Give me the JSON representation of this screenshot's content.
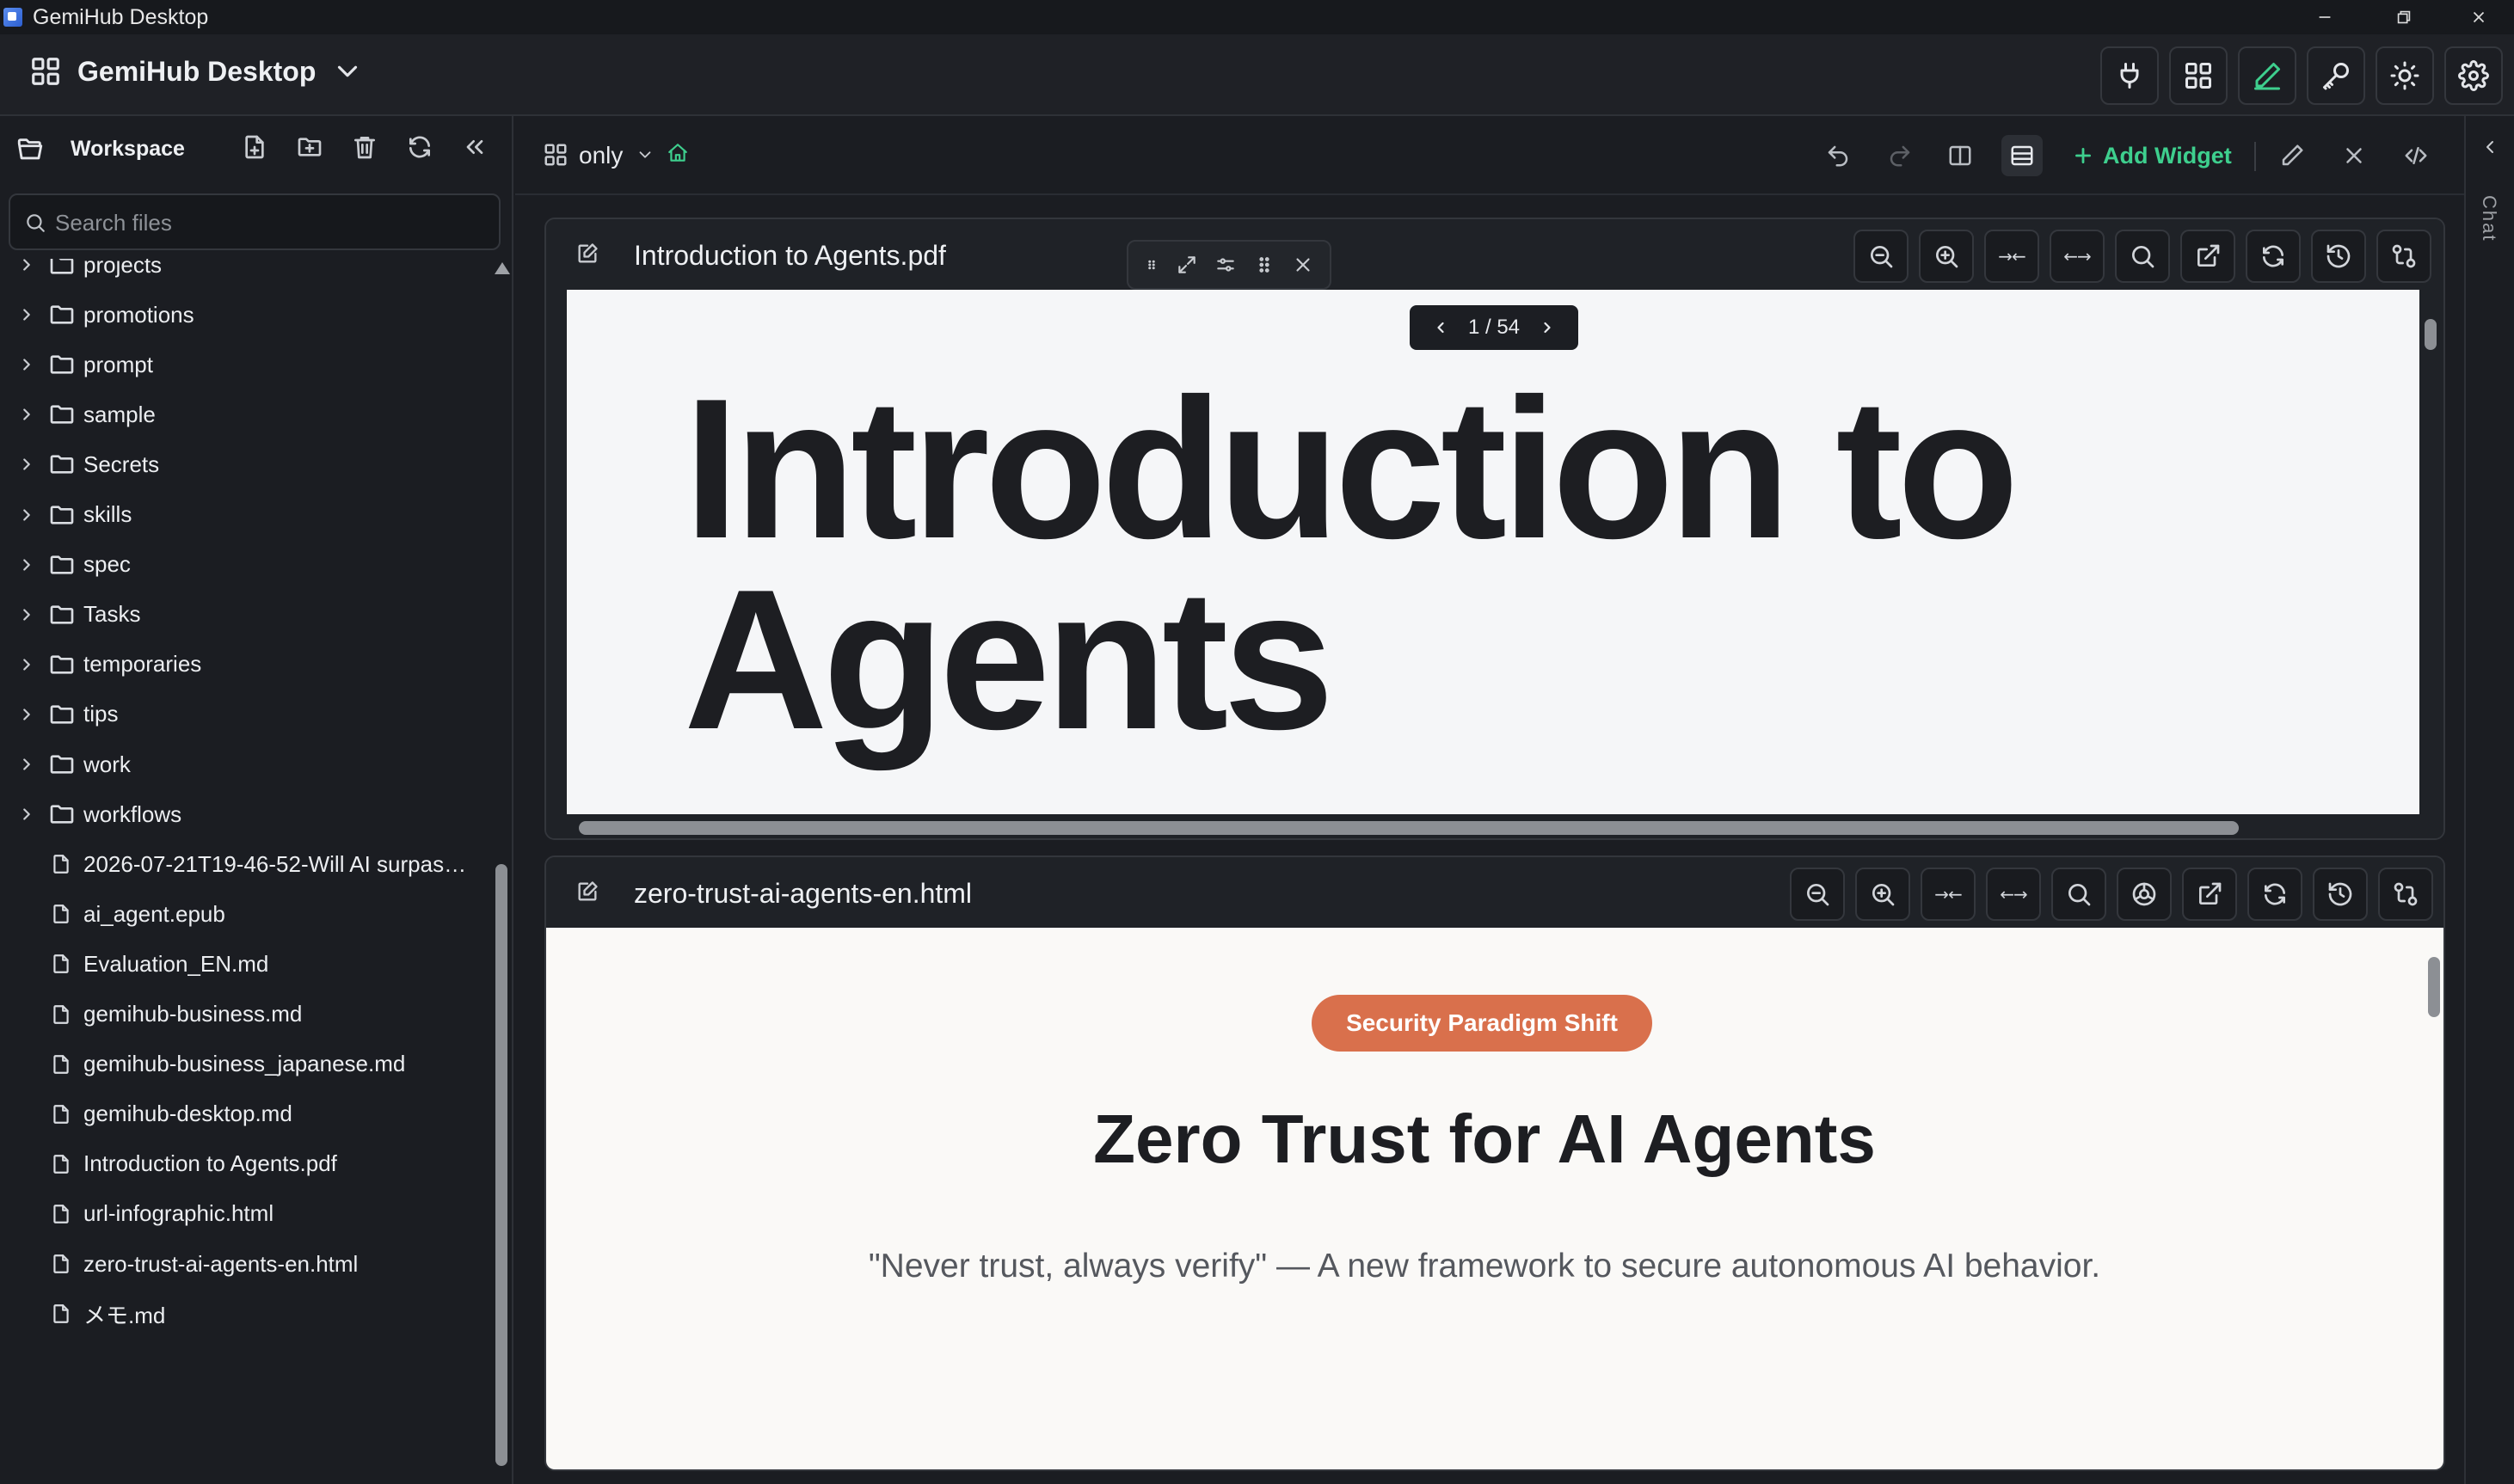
{
  "window": {
    "title": "GemiHub Desktop"
  },
  "header": {
    "app_name": "GemiHub Desktop"
  },
  "workspace": {
    "title": "Workspace",
    "search_placeholder": "Search files",
    "tree": [
      {
        "type": "folder",
        "name": "projects"
      },
      {
        "type": "folder",
        "name": "promotions"
      },
      {
        "type": "folder",
        "name": "prompt"
      },
      {
        "type": "folder",
        "name": "sample"
      },
      {
        "type": "folder",
        "name": "Secrets"
      },
      {
        "type": "folder",
        "name": "skills"
      },
      {
        "type": "folder",
        "name": "spec"
      },
      {
        "type": "folder",
        "name": "Tasks"
      },
      {
        "type": "folder",
        "name": "temporaries"
      },
      {
        "type": "folder",
        "name": "tips"
      },
      {
        "type": "folder",
        "name": "work"
      },
      {
        "type": "folder",
        "name": "workflows"
      },
      {
        "type": "file",
        "name": "2026-07-21T19-46-52-Will AI surpass ..."
      },
      {
        "type": "file",
        "name": "ai_agent.epub"
      },
      {
        "type": "file",
        "name": "Evaluation_EN.md"
      },
      {
        "type": "file",
        "name": "gemihub-business.md"
      },
      {
        "type": "file",
        "name": "gemihub-business_japanese.md"
      },
      {
        "type": "file",
        "name": "gemihub-desktop.md"
      },
      {
        "type": "file",
        "name": "Introduction to Agents.pdf"
      },
      {
        "type": "file",
        "name": "url-infographic.html"
      },
      {
        "type": "file",
        "name": "zero-trust-ai-agents-en.html"
      },
      {
        "type": "file",
        "name": "メモ.md"
      }
    ]
  },
  "toolbar": {
    "layout_name": "only",
    "add_widget_label": "Add Widget"
  },
  "widgets": {
    "pdf": {
      "title": "Introduction to Agents.pdf",
      "page_indicator": "1 / 54",
      "content_title": "Introduction to Agents",
      "fit_width_label": "→←",
      "fit_page_label": "←→"
    },
    "html": {
      "title": "zero-trust-ai-agents-en.html",
      "badge": "Security Paradigm Shift",
      "heading": "Zero Trust for AI Agents",
      "subtitle": "\"Never trust, always verify\" — A new framework to secure autonomous AI behavior.",
      "fit_width_label": "→←",
      "fit_page_label": "←→"
    }
  },
  "chat": {
    "label": "Chat"
  },
  "colors": {
    "accent": "#3ecf8e",
    "badge": "#d9704c",
    "bg": "#1b1d22"
  }
}
